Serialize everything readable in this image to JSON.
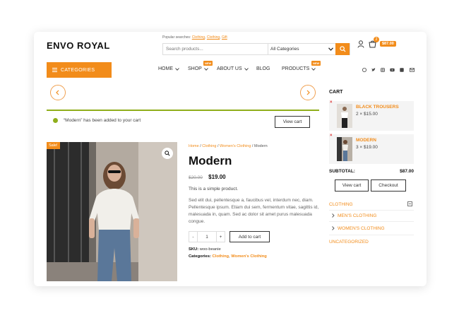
{
  "header": {
    "logo": "ENVO ROYAL",
    "popular_label": "Popular searches:",
    "popular_links": [
      "Clothing",
      "Clothing",
      "Gift"
    ],
    "search_placeholder": "Search products...",
    "category_select": "All Categories",
    "cart_count": "2",
    "cart_amount": "$87.00"
  },
  "nav": {
    "categories": "CATEGORIES",
    "items": [
      "HOME",
      "SHOP",
      "ABOUT US",
      "BLOG",
      "PRODUCTS"
    ],
    "new_tag": "NEW"
  },
  "notice": {
    "message": "“Modern” has been added to your cart",
    "view_cart": "View cart"
  },
  "product": {
    "sale": "Sale!",
    "breadcrumb": [
      "Home",
      "Clothing",
      "Women's Clothing",
      "Modern"
    ],
    "title": "Modern",
    "old_price": "$20.00",
    "price": "$19.00",
    "short_description": "This is a simple product.",
    "description": "Sed elit dui, pellentesque a, faucibus vel, interdum nec, diam. Pellentesque ipsum. Etiam dui sem, fermentum vitae, sagittis id, malesuada in, quam. Sed ac dolor sit amet purus malesuada congue.",
    "quantity": "1",
    "add_to_cart": "Add to cart",
    "sku_label": "SKU:",
    "sku": "woo-beanie",
    "categories_label": "Categories:",
    "categories": [
      "Clothing",
      "Women's Clothing"
    ]
  },
  "sidebar": {
    "cart_heading": "CART",
    "cart_items": [
      {
        "name": "BLACK TROUSERS",
        "qty": "2 × $15.00"
      },
      {
        "name": "MODERN",
        "qty": "3 × $19.00"
      }
    ],
    "subtotal_label": "SUBTOTAL:",
    "subtotal": "$87.00",
    "view_cart": "View cart",
    "checkout": "Checkout",
    "categories": [
      "CLOTHING",
      "MEN'S CLOTHING",
      "WOMEN'S CLOTHING",
      "UNCATEGORIZED"
    ]
  },
  "colors": {
    "accent": "#f28c1a",
    "success": "#8fae1b"
  }
}
